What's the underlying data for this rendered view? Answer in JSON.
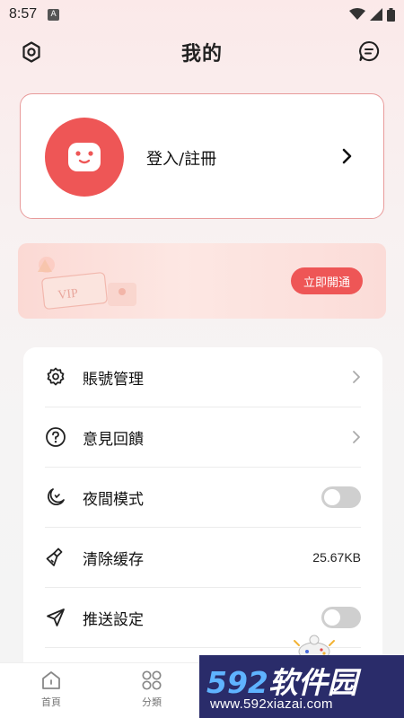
{
  "status_bar": {
    "time": "8:57",
    "notification_badge": "A"
  },
  "header": {
    "title": "我的",
    "left_icon": "settings-icon",
    "right_icon": "message-icon"
  },
  "profile": {
    "login_label": "登入/註冊",
    "avatar_icon": "face-icon",
    "chevron": "chevron-right-icon"
  },
  "vip_banner": {
    "badge_text": "VIP",
    "button_label": "立即開通"
  },
  "menu": {
    "items": [
      {
        "label": "賬號管理",
        "icon": "gear-icon",
        "type": "link"
      },
      {
        "label": "意見回饋",
        "icon": "question-icon",
        "type": "link"
      },
      {
        "label": "夜間模式",
        "icon": "moon-icon",
        "type": "toggle",
        "on": false
      },
      {
        "label": "清除缓存",
        "icon": "broom-icon",
        "type": "value",
        "value": "25.67KB"
      },
      {
        "label": "推送設定",
        "icon": "send-icon",
        "type": "toggle",
        "on": false
      }
    ]
  },
  "bottom_nav": {
    "items": [
      {
        "label": "首頁",
        "icon": "home-icon"
      },
      {
        "label": "分類",
        "icon": "category-icon"
      }
    ]
  },
  "watermark": {
    "brand_num": "592",
    "brand_text": "软件园",
    "url": "www.592xiazai.com"
  },
  "colors": {
    "accent": "#ee5656",
    "toggle_off": "#cfcfcf"
  }
}
